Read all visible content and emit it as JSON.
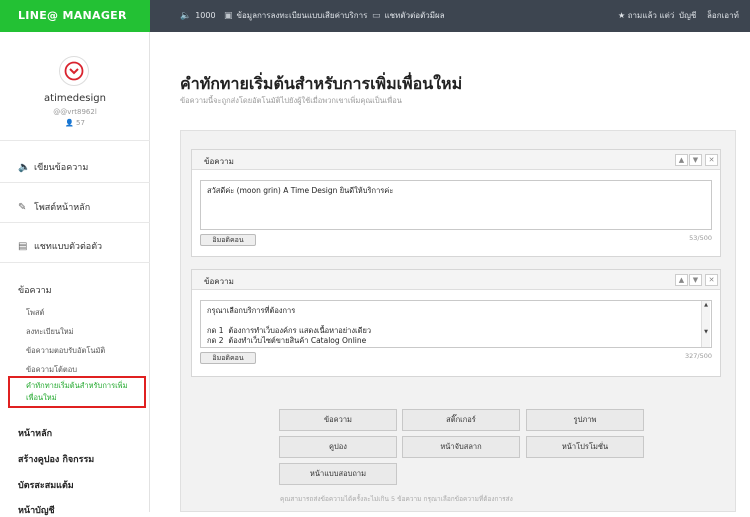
{
  "header": {
    "logo": "LINE@ MANAGER",
    "friend_count": "1000",
    "nav": [
      "ข้อมูลการลงทะเบียนแบบเสียค่าบริการ",
      "แชทตัวต่อตัวมีผล"
    ],
    "right_items": [
      "★ ถามแล้ว แต่ว่",
      "บัญชี",
      "ล็อกเอาท์"
    ]
  },
  "profile": {
    "name": "atimedesign",
    "id": "@vrt8962l",
    "friends": "57"
  },
  "sidebar": {
    "menu": [
      "เขียนข้อความ",
      "โพสต์หน้าหลัก",
      "แชทแบบตัวต่อตัว"
    ],
    "section_label": "ข้อความ",
    "sub_items": [
      "โพสต์",
      "ลงทะเบียนใหม่",
      "ข้อความตอบรับอัตโนมัติ",
      "ข้อความโต้ตอบ"
    ],
    "active_item": "คำทักทายเริ่มต้นสำหรับการเพิ่มเพื่อนใหม่",
    "bold_items": [
      "หน้าหลัก",
      "สร้างคูปอง กิจกรรม",
      "บัตรสะสมแต้ม",
      "หน้าบัญชี"
    ]
  },
  "main": {
    "title": "คำทักทายเริ่มต้นสำหรับการเพิ่มเพื่อนใหม่",
    "subtitle": "ข้อความนี้จะถูกส่งโดยอัตโนมัติไปยังผู้ใช้เมื่อพวกเขาเพิ่มคุณเป็นเพื่อน",
    "messages": [
      {
        "label": "ข้อความ",
        "text": "สวัสดีค่ะ (moon grin) A Time Design ยินดีให้บริการค่ะ",
        "emoji_button": "อิมอติคอน",
        "counter": "53/500"
      },
      {
        "label": "ข้อความ",
        "text": "กรุณาเลือกบริการที่ต้องการ\n\nกด 1  ต้องการทำเว็บองค์กร แสดงเนื้อหาอย่างเดียว\nกด 2  ต้องทำเว็บไซต์ขายสินค้า Catalog Online",
        "emoji_button": "อิมอติคอน",
        "counter": "327/500"
      }
    ],
    "type_buttons": [
      "ข้อความ",
      "สติ๊กเกอร์",
      "รูปภาพ",
      "คูปอง",
      "หน้าจับสลาก",
      "หน้าโปรโมชั่น",
      "หน้าแบบสอบถาม"
    ],
    "note": "คุณสามารถส่งข้อความได้ครั้งละไม่เกิน 5 ข้อความ กรุณาเลือกข้อความที่ต้องการส่ง"
  },
  "colors": {
    "brand_green": "#23c134",
    "topbar": "#3d4550",
    "highlight_red": "#e02020"
  }
}
